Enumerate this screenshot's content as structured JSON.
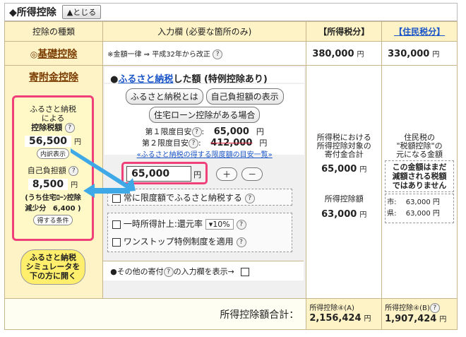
{
  "header": {
    "title": "◆所得控除",
    "close_label": "▲とじる"
  },
  "columns": {
    "type": "控除の種類",
    "input": "入力欄 (必要な箇所のみ)",
    "income_tax": "【所得税分】",
    "resident_tax": "【住民税分】"
  },
  "kiso": {
    "prefix": "◎",
    "label": "基礎控除",
    "note": "※金額一律 ⇒ 平成32年から改正",
    "income_value": "380,000",
    "resident_value": "330,000",
    "yen": "円"
  },
  "kifu": {
    "label": "寄附金控除",
    "box": {
      "furusato_line1": "ふるさと納税",
      "furusato_line2": "による",
      "furusato_line3": "控除税額",
      "tax_value": "56,500",
      "yen": "円",
      "detail_btn": "内訳表示",
      "self_burden_label": "自己負担額",
      "self_burden_value": "8,500",
      "housing_note": "(うち住宅ﾛｰﾝ控除",
      "reduction_label": "減少分",
      "reduction_value": "6,400",
      "close_paren": ")",
      "condition_btn": "得する条件"
    },
    "sim_btn_lines": [
      "ふるさと納税",
      "シミュレータを",
      "下の方に開く"
    ],
    "mid": {
      "bullet": "●",
      "title_link": "ふるさと納税",
      "title_rest": "した額 (特例控除あり)",
      "btn_what": "ふるさと納税とは",
      "btn_burden": "自己負担額の表示",
      "btn_housing": "住宅ローン控除がある場合",
      "limit1_label": "第１限度目安",
      "limit1_value": "65,000",
      "limit2_label": "第２限度目安",
      "limit2_value": "412,000",
      "limit_link": "«ふるさと納税の得する限度額の目安一覧»",
      "input_value": "65,000",
      "yen": "円",
      "plus": "＋",
      "minus": "－",
      "always_limit": "常に限度額でふるさと納税する",
      "temp_income": "一時所得計上:還元率",
      "rate": "10%",
      "onestop": "ワンストップ特例制度を適用",
      "other_donation": "●その他の寄付",
      "other_donation_rest": "の入力欄を表示→"
    },
    "right": {
      "income_note_1": "所得税における",
      "income_note_2": "所得控除対象の",
      "income_note_3": "寄付金合計",
      "income_sum": "65,000",
      "income_deduct_label": "所得控除額",
      "income_deduct": "63,000",
      "res_note_1": "住民税の",
      "res_note_2": "\"税額控除\"の",
      "res_note_3": "元になる金額",
      "res_warning_1": "この金額はまだ",
      "res_warning_2": "減額される税額",
      "res_warning_3": "ではありません",
      "city_label": "市:",
      "city_value": "63,000",
      "pref_label": "県:",
      "pref_value": "63,000"
    }
  },
  "total": {
    "label": "所得控除額合計：",
    "income_label": "所得控除④(A)",
    "income_value": "2,156,424",
    "resident_label": "所得控除④(B)",
    "resident_value": "1,907,424",
    "yen": "円"
  },
  "q": "?",
  "colors": {
    "accent_pink": "#f0407a",
    "cream": "#fdf3c7",
    "arrow_blue": "#3fa9e8"
  }
}
